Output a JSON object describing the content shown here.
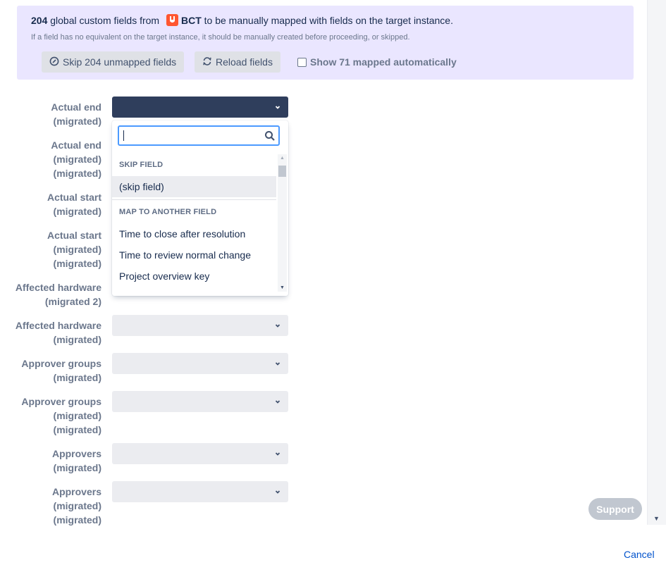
{
  "banner": {
    "count": "204",
    "text_before": " global custom fields from ",
    "project": "BCT",
    "text_after": " to be manually mapped with fields on the target instance.",
    "note": "If a field has no equivalent on the target instance, it should be manually created before proceeding, or skipped."
  },
  "buttons": {
    "skip_label": "Skip 204 unmapped fields",
    "reload_label": "Reload fields",
    "show_mapped_label": "Show 71 mapped automatically",
    "show_mapped_checked": false
  },
  "fields": [
    {
      "line1": "Actual end",
      "line2": "(migrated)",
      "line3": ""
    },
    {
      "line1": "Actual end",
      "line2": "(migrated)",
      "line3": "(migrated)"
    },
    {
      "line1": "Actual start",
      "line2": "(migrated)",
      "line3": ""
    },
    {
      "line1": "Actual start",
      "line2": "(migrated)",
      "line3": "(migrated)"
    },
    {
      "line1": "Affected hardware",
      "line2": "(migrated 2)",
      "line3": ""
    },
    {
      "line1": "Affected hardware",
      "line2": "(migrated)",
      "line3": ""
    },
    {
      "line1": "Approver groups",
      "line2": "(migrated)",
      "line3": ""
    },
    {
      "line1": "Approver groups",
      "line2": "(migrated)",
      "line3": "(migrated)"
    },
    {
      "line1": "Approvers",
      "line2": "(migrated)",
      "line3": ""
    },
    {
      "line1": "Approvers",
      "line2": "(migrated)",
      "line3": "(migrated)"
    }
  ],
  "dropdown": {
    "search_value": "",
    "group_skip": "SKIP FIELD",
    "skip_option": "(skip field)",
    "group_map": "MAP TO ANOTHER FIELD",
    "options": [
      "Time to close after resolution",
      "Time to review normal change",
      "Project overview key"
    ]
  },
  "footer": {
    "support_label": "Support",
    "cancel_label": "Cancel"
  },
  "colors": {
    "banner_bg": "#eae6ff",
    "active_select": "#2f3e5c",
    "focus_ring": "#4c9aff",
    "link": "#0052cc",
    "project_icon": "#ff5630"
  },
  "icons": {
    "skip": "circle-slash-icon",
    "reload": "refresh-icon",
    "search": "search-icon",
    "chevron": "chevron-down-icon",
    "project": "project-avatar-icon"
  }
}
